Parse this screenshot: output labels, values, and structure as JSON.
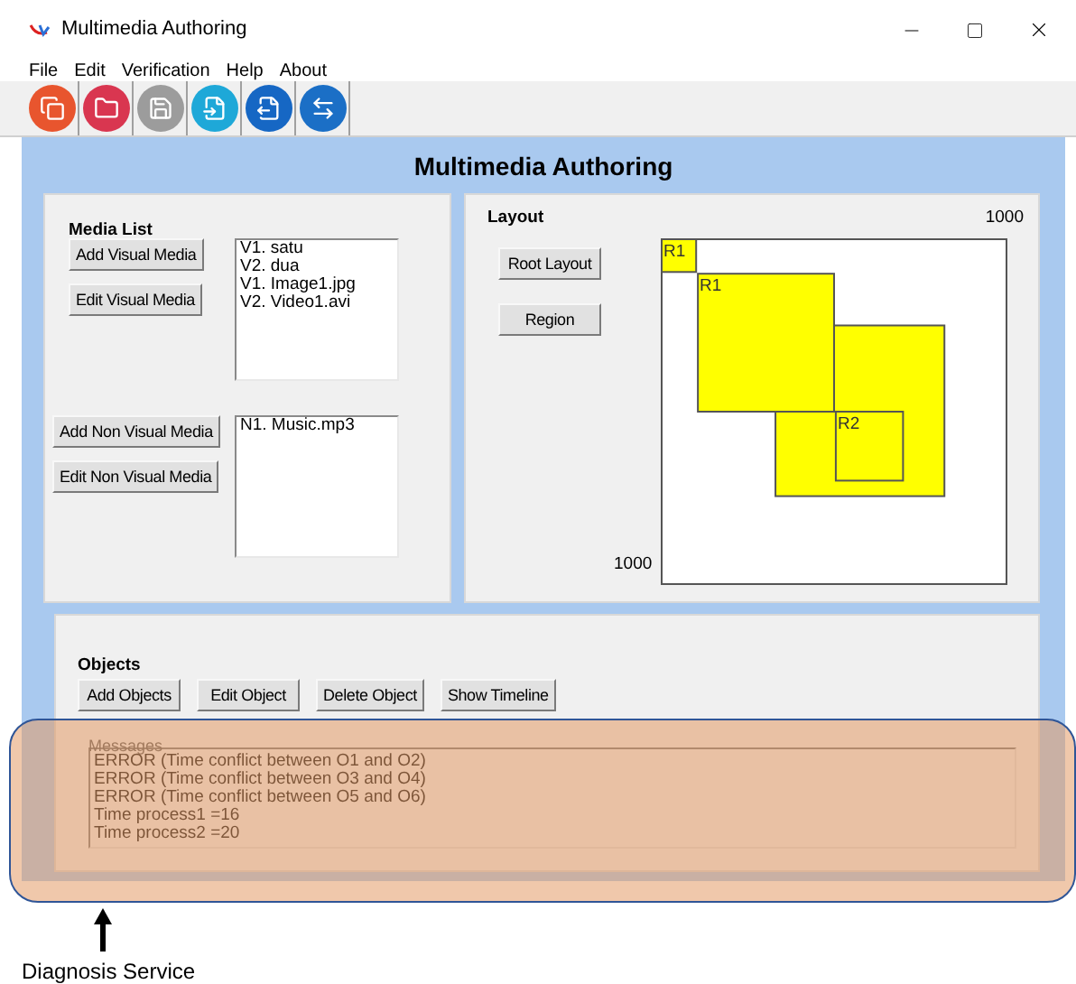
{
  "window": {
    "title": "Multimedia Authoring"
  },
  "menu": [
    "File",
    "Edit",
    "Verification",
    "Help",
    "About"
  ],
  "toolbar": [
    {
      "kind": "copy",
      "color": "#e8552e"
    },
    {
      "kind": "open",
      "color": "#d93650"
    },
    {
      "kind": "save",
      "color": "#9c9c9c"
    },
    {
      "kind": "import",
      "color": "#1ea8d8"
    },
    {
      "kind": "export",
      "color": "#1667c4"
    },
    {
      "kind": "swap",
      "color": "#1b6fc6"
    }
  ],
  "heading": "Multimedia Authoring",
  "media_list": {
    "title": "Media List",
    "visual_buttons": [
      "Add Visual Media",
      "Edit Visual Media"
    ],
    "visual_items": [
      "V1. satu",
      "V2. dua",
      "V1. Image1.jpg",
      "V2. Video1.avi"
    ],
    "non_visual_buttons": [
      "Add Non Visual Media",
      "Edit Non Visual Media"
    ],
    "non_visual_items": [
      "N1. Music.mp3"
    ]
  },
  "layout": {
    "title": "Layout",
    "buttons": [
      "Root Layout",
      "Region"
    ],
    "width_label": "1000",
    "height_label": "1000",
    "regions": [
      {
        "kind": "labeled",
        "label": "R1"
      },
      {
        "kind": "labeled",
        "label": "R1"
      },
      {
        "kind": "blank"
      },
      {
        "kind": "labeled",
        "label": "R2"
      }
    ]
  },
  "objects": {
    "title": "Objects",
    "buttons": [
      "Add Objects",
      "Edit Object",
      "Delete Object",
      "Show Timeline"
    ]
  },
  "messages": {
    "title": "Messages",
    "lines": [
      "ERROR (Time conflict between O1 and O2)",
      "ERROR (Time conflict between O3 and O4)",
      "ERROR (Time conflict between O5 and O6)",
      "Time process1 =16",
      "Time process2 =20"
    ]
  },
  "annotation": {
    "label": "Diagnosis Service"
  }
}
